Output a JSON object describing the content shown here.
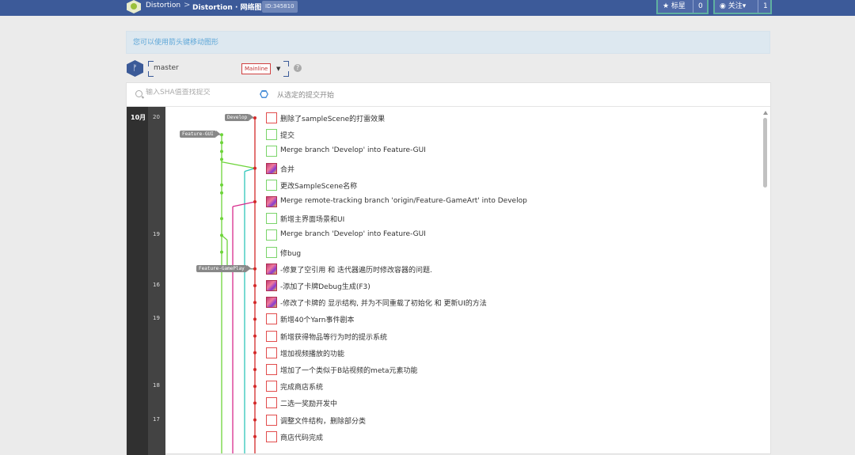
{
  "header": {
    "project": "Distortion",
    "separator": ">",
    "page_title": "Distortion · 网络图",
    "id_badge": "ID:345810",
    "star_label": "★ 标星",
    "star_count": "0",
    "watch_label": "◉ 关注▾",
    "watch_count": "1"
  },
  "tip": "您可以使用箭头键移动图形",
  "branch": {
    "icon": "branch-icon",
    "name": "master",
    "mainline_label": "Mainline",
    "help": "?"
  },
  "search": {
    "placeholder": "输入SHA值查找提交",
    "from_selected": "从选定的提交开始"
  },
  "dates": {
    "month": "10月",
    "days": [
      {
        "row": 0,
        "day": "20"
      },
      {
        "row": 7,
        "day": "19"
      },
      {
        "row": 10,
        "day": "16"
      },
      {
        "row": 12,
        "day": "19"
      },
      {
        "row": 16,
        "day": "18"
      },
      {
        "row": 18,
        "day": "17"
      }
    ]
  },
  "branch_tags": [
    {
      "row": 0,
      "label": "Develop"
    },
    {
      "row": 1,
      "label": "Feature-GUI"
    },
    {
      "row": 9,
      "label": "Feature-GamePlay"
    }
  ],
  "commits": [
    {
      "message": "删除了sampleScene的打雷效果",
      "avatar": "red"
    },
    {
      "message": "提交",
      "avatar": "green"
    },
    {
      "message": "Merge branch 'Develop' into Feature-GUI",
      "avatar": "green"
    },
    {
      "message": "合并",
      "avatar": "avatar"
    },
    {
      "message": "更改SampleScene名称",
      "avatar": "green"
    },
    {
      "message": "Merge remote-tracking branch 'origin/Feature-GameArt' into Develop",
      "avatar": "avatar"
    },
    {
      "message": "新增主界面场景和UI",
      "avatar": "green"
    },
    {
      "message": "Merge branch 'Develop' into Feature-GUI",
      "avatar": "green"
    },
    {
      "message": "修bug",
      "avatar": "green"
    },
    {
      "message": "-修复了空引用 和 迭代器遍历时修改容器的问题.",
      "avatar": "avatar"
    },
    {
      "message": "-添加了卡牌Debug生成(F3)",
      "avatar": "avatar"
    },
    {
      "message": "-修改了卡牌的 显示结构, 并为不同重载了初始化 和 更新UI的方法",
      "avatar": "avatar"
    },
    {
      "message": "新增40个Yarn事件剧本",
      "avatar": "red"
    },
    {
      "message": "新增获得物品等行为时的提示系统",
      "avatar": "red"
    },
    {
      "message": "增加视频播放的功能",
      "avatar": "red"
    },
    {
      "message": "增加了一个类似于B站视频的meta元素功能",
      "avatar": "red"
    },
    {
      "message": "完成商店系统",
      "avatar": "red"
    },
    {
      "message": "二选一奖励开发中",
      "avatar": "red"
    },
    {
      "message": "调整文件结构，删除部分类",
      "avatar": "red"
    },
    {
      "message": "商店代码完成",
      "avatar": "red"
    }
  ],
  "colors": {
    "develop": "#d42a2a",
    "feature_gui": "#6dd43a",
    "feature_gameart": "#d82b8c",
    "feature_gameplay": "#2fc7b9"
  }
}
